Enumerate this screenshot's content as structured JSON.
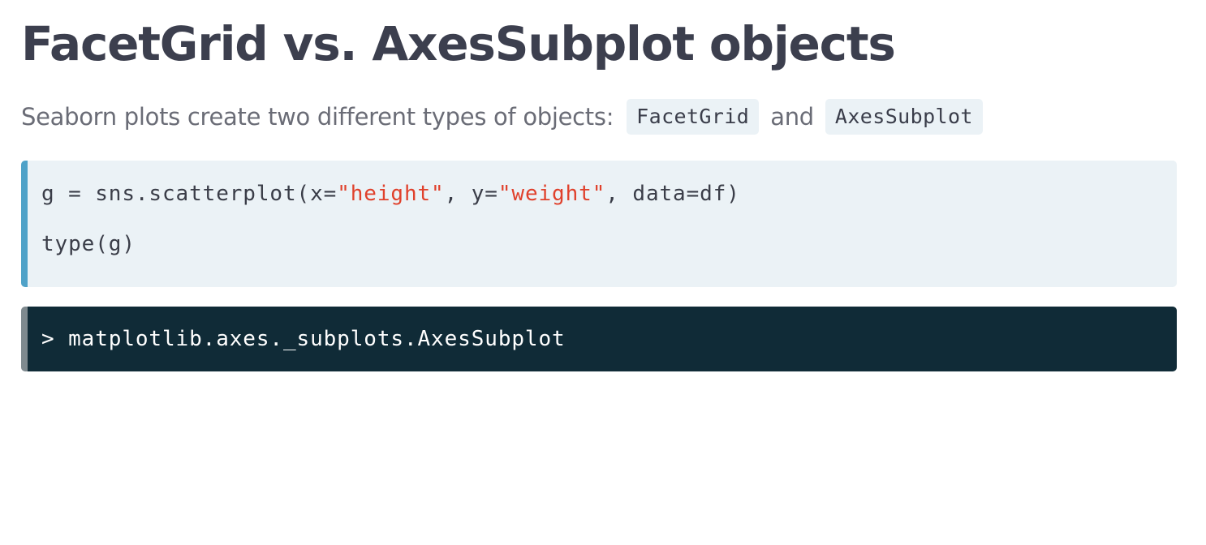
{
  "title": "FacetGrid vs. AxesSubplot objects",
  "intro": {
    "text": "Seaborn plots create two different types of objects:",
    "code_1": "FacetGrid",
    "conjunction": "and",
    "code_2": "AxesSubplot"
  },
  "code": {
    "line1_prefix": "g = sns.scatterplot(x=",
    "line1_str1": "\"height\"",
    "line1_mid": ", y=",
    "line1_str2": "\"weight\"",
    "line1_suffix": ", data=df)",
    "line2": "type(g)"
  },
  "output": {
    "text": "> matplotlib.axes._subplots.AxesSubplot"
  },
  "colors": {
    "code_bg": "#ebf2f6",
    "code_accent": "#4fa2c8",
    "string": "#e0412c",
    "output_bg": "#102b37",
    "output_accent": "#7f8a8f"
  }
}
